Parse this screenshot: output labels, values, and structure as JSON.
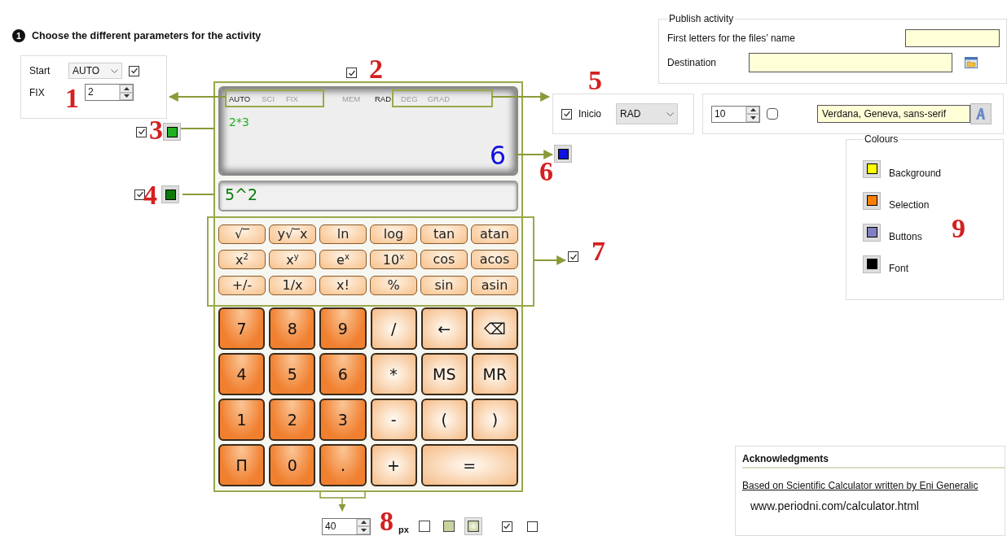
{
  "heading": {
    "step": "1",
    "text": "Choose the different parameters for the activity"
  },
  "start_panel": {
    "label": "Start",
    "mode": "AUTO",
    "checked": true,
    "fix_label": "FIX",
    "fix_value": "2"
  },
  "result_option": {
    "color": "#1010e0"
  },
  "display": {
    "checked": true,
    "expression": "2*3",
    "result": "6",
    "indicators": [
      {
        "label": "AUTO",
        "on": true
      },
      {
        "label": "SCI",
        "on": false
      },
      {
        "label": "FIX",
        "on": false
      },
      {
        "label": "MEM",
        "on": false
      },
      {
        "label": "RAD",
        "on": true
      },
      {
        "label": "DEG",
        "on": false
      },
      {
        "label": "GRAD",
        "on": false
      }
    ]
  },
  "expression_option": {
    "checked": true,
    "color": "#22b022"
  },
  "input_option": {
    "checked": true,
    "color": "#0b7a0b"
  },
  "input": "5^2",
  "scientific_keys": {
    "checked": true,
    "keys": [
      {
        "label": "√‾"
      },
      {
        "label": "y√‾x"
      },
      {
        "label": "ln"
      },
      {
        "label": "log"
      },
      {
        "label": "tan"
      },
      {
        "label": "atan"
      },
      {
        "label": "x$^{2}$"
      },
      {
        "label": "x$^{y}$"
      },
      {
        "label": "e$^{x}$"
      },
      {
        "label": "10$^{x}$"
      },
      {
        "label": "cos"
      },
      {
        "label": "acos"
      },
      {
        "label": "+/-"
      },
      {
        "label": "1/x"
      },
      {
        "label": "x!"
      },
      {
        "label": "%"
      },
      {
        "label": "sin"
      },
      {
        "label": "asin"
      }
    ]
  },
  "keys": [
    {
      "label": "7",
      "kind": "digit"
    },
    {
      "label": "8",
      "kind": "digit"
    },
    {
      "label": "9",
      "kind": "digit"
    },
    {
      "label": "/",
      "kind": "op"
    },
    {
      "label": "←",
      "kind": "op"
    },
    {
      "label": "⌫",
      "kind": "op"
    },
    {
      "label": "4",
      "kind": "digit"
    },
    {
      "label": "5",
      "kind": "digit"
    },
    {
      "label": "6",
      "kind": "digit"
    },
    {
      "label": "*",
      "kind": "op"
    },
    {
      "label": "MS",
      "kind": "op"
    },
    {
      "label": "MR",
      "kind": "op"
    },
    {
      "label": "1",
      "kind": "digit"
    },
    {
      "label": "2",
      "kind": "digit"
    },
    {
      "label": "3",
      "kind": "digit"
    },
    {
      "label": "-",
      "kind": "op"
    },
    {
      "label": "(",
      "kind": "op"
    },
    {
      "label": ")",
      "kind": "op"
    },
    {
      "label": "Π",
      "kind": "digit"
    },
    {
      "label": "0",
      "kind": "digit"
    },
    {
      "label": ".",
      "kind": "digit"
    },
    {
      "label": "+",
      "kind": "op"
    },
    {
      "label": "=",
      "kind": "wide"
    }
  ],
  "start_angle": {
    "checked": true,
    "label": "Inicio",
    "value": "RAD"
  },
  "font": {
    "size": "10",
    "checked": false,
    "family": "Verdana, Geneva, sans-serif"
  },
  "publish": {
    "title": "Publish activity",
    "prefix_label": "First letters for the files’ name",
    "destination_label": "Destination"
  },
  "colours": {
    "title": "Colours",
    "items": [
      {
        "label": "Background",
        "color": "#ffff00"
      },
      {
        "label": "Selection",
        "color": "#ff8000"
      },
      {
        "label": "Buttons",
        "color": "#8080c0"
      },
      {
        "label": "Font",
        "color": "#000000"
      }
    ]
  },
  "key_size": {
    "value": "40",
    "unit": "px",
    "styles": [
      {
        "kind": "plain",
        "selected": false
      },
      {
        "kind": "flat",
        "selected": false
      },
      {
        "kind": "gradient",
        "selected": true
      }
    ],
    "options": [
      {
        "checked": true
      },
      {
        "checked": false
      }
    ]
  },
  "acknowledgments": {
    "title": "Acknowledgments",
    "credit": "Based on Scientific Calculator written by Eni Generalic",
    "url": "www.periodni.com/calculator.html"
  },
  "callouts": [
    "1",
    "2",
    "3",
    "4",
    "5",
    "6",
    "7",
    "8",
    "9"
  ]
}
